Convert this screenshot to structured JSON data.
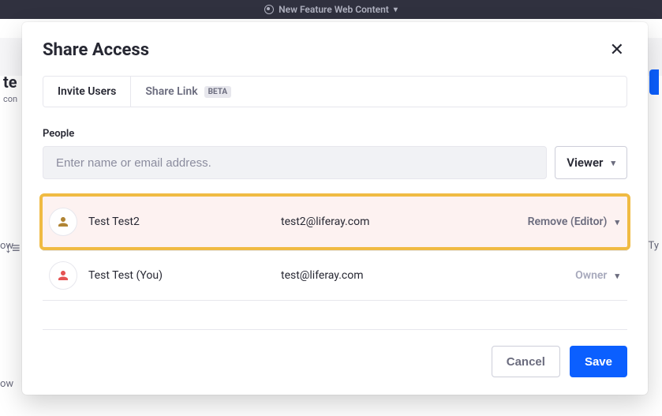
{
  "topbar": {
    "title": "New Feature Web Content"
  },
  "ghost": {
    "title_fragment": "te",
    "subtitle_fragment": "con",
    "ow1": "ow",
    "ow2": "ow",
    "ty_fragment": "e Ty",
    "sort_glyph": "↓≡"
  },
  "modal": {
    "title": "Share Access",
    "tabs": [
      {
        "label": "Invite Users",
        "badge": null,
        "active": true
      },
      {
        "label": "Share Link",
        "badge": "BETA",
        "active": false
      }
    ],
    "people": {
      "label": "People",
      "placeholder": "Enter name or email address.",
      "role_default": "Viewer"
    },
    "users": [
      {
        "name": "Test Test2",
        "email": "test2@liferay.com",
        "role_label": "Remove (Editor)",
        "avatar_color": "#b08434",
        "highlight": true,
        "role_style": "default"
      },
      {
        "name": "Test Test (You)",
        "email": "test@liferay.com",
        "role_label": "Owner",
        "avatar_color": "#e55353",
        "highlight": false,
        "role_style": "owner"
      }
    ],
    "footer": {
      "cancel": "Cancel",
      "save": "Save"
    }
  }
}
